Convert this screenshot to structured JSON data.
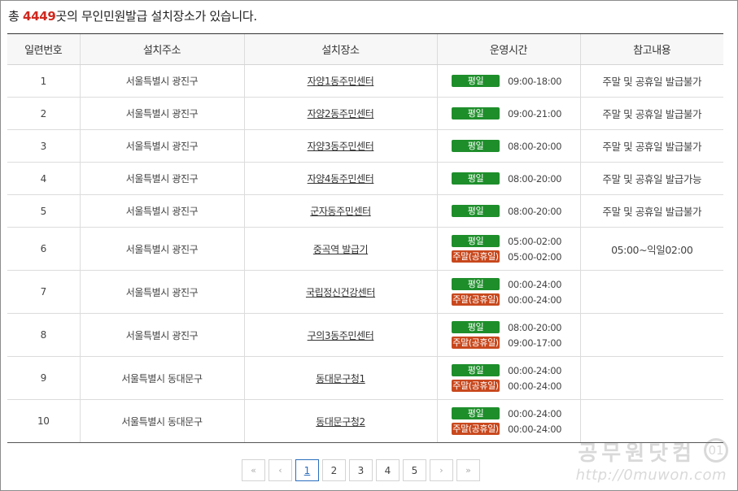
{
  "summary": {
    "prefix": "총 ",
    "count": "4449",
    "suffix": "곳의 무인민원발급 설치장소가 있습니다."
  },
  "table": {
    "headers": [
      "일련번호",
      "설치주소",
      "설치장소",
      "운영시간",
      "참고내용"
    ],
    "rows": [
      {
        "no": "1",
        "address": "서울특별시 광진구",
        "place": "자양1동주민센터",
        "hours": [
          {
            "label": "평일",
            "time": "09:00-18:00"
          }
        ],
        "note": "주말 및 공휴일 발급불가"
      },
      {
        "no": "2",
        "address": "서울특별시 광진구",
        "place": "자양2동주민센터",
        "hours": [
          {
            "label": "평일",
            "time": "09:00-21:00"
          }
        ],
        "note": "주말 및 공휴일 발급불가"
      },
      {
        "no": "3",
        "address": "서울특별시 광진구",
        "place": "자양3동주민센터",
        "hours": [
          {
            "label": "평일",
            "time": "08:00-20:00"
          }
        ],
        "note": "주말 및 공휴일 발급불가"
      },
      {
        "no": "4",
        "address": "서울특별시 광진구",
        "place": "자양4동주민센터",
        "hours": [
          {
            "label": "평일",
            "time": "08:00-20:00"
          }
        ],
        "note": "주말 및 공휴일 발급가능"
      },
      {
        "no": "5",
        "address": "서울특별시 광진구",
        "place": "군자동주민센터",
        "hours": [
          {
            "label": "평일",
            "time": "08:00-20:00"
          }
        ],
        "note": "주말 및 공휴일 발급불가"
      },
      {
        "no": "6",
        "address": "서울특별시 광진구",
        "place": "중곡역 발급기",
        "hours": [
          {
            "label": "평일",
            "time": "05:00-02:00"
          },
          {
            "label": "주말(공휴일)",
            "time": "05:00-02:00"
          }
        ],
        "note": "05:00~익일02:00"
      },
      {
        "no": "7",
        "address": "서울특별시 광진구",
        "place": "국립정신건강센터",
        "hours": [
          {
            "label": "평일",
            "time": "00:00-24:00"
          },
          {
            "label": "주말(공휴일)",
            "time": "00:00-24:00"
          }
        ],
        "note": ""
      },
      {
        "no": "8",
        "address": "서울특별시 광진구",
        "place": "구의3동주민센터",
        "hours": [
          {
            "label": "평일",
            "time": "08:00-20:00"
          },
          {
            "label": "주말(공휴일)",
            "time": "09:00-17:00"
          }
        ],
        "note": ""
      },
      {
        "no": "9",
        "address": "서울특별시 동대문구",
        "place": "동대문구청1",
        "hours": [
          {
            "label": "평일",
            "time": "00:00-24:00"
          },
          {
            "label": "주말(공휴일)",
            "time": "00:00-24:00"
          }
        ],
        "note": ""
      },
      {
        "no": "10",
        "address": "서울특별시 동대문구",
        "place": "동대문구청2",
        "hours": [
          {
            "label": "평일",
            "time": "00:00-24:00"
          },
          {
            "label": "주말(공휴일)",
            "time": "00:00-24:00"
          }
        ],
        "note": ""
      }
    ]
  },
  "pagination": {
    "first_icon": "«",
    "prev_icon": "‹",
    "next_icon": "›",
    "last_icon": "»",
    "pages": [
      "1",
      "2",
      "3",
      "4",
      "5"
    ],
    "current": "1"
  },
  "watermark": {
    "title": "공무원닷컴",
    "url": "http://0muwon.com",
    "logo": "01"
  },
  "colors": {
    "weekday_badge": "#1e8e2b",
    "weekend_badge": "#c8481d",
    "count_highlight": "#d0281e",
    "active_page": "#2b6ebd"
  }
}
